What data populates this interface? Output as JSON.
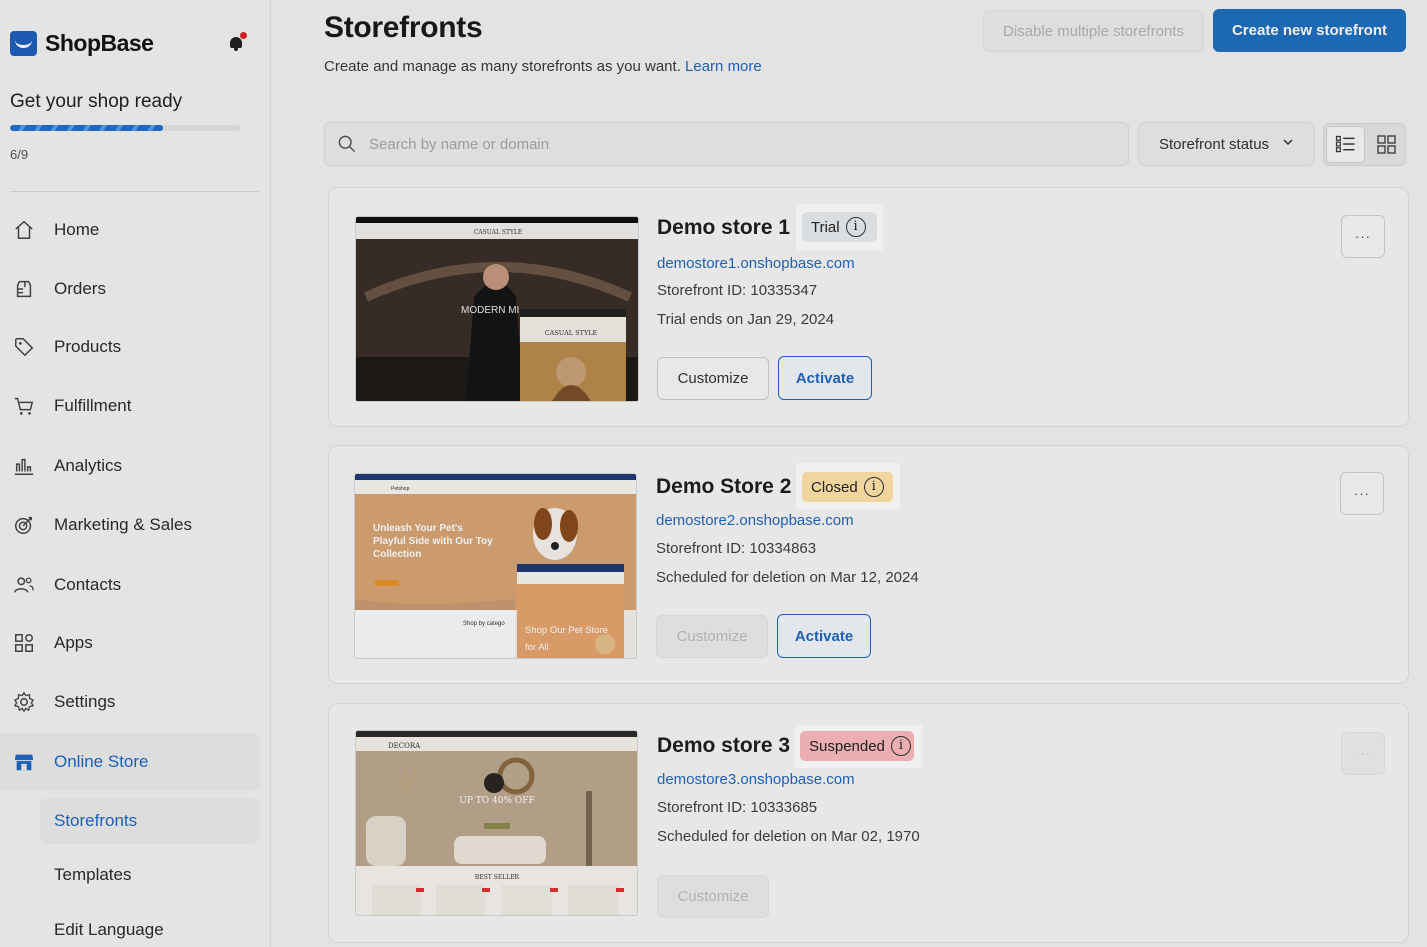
{
  "sidebar": {
    "brand": "ShopBase",
    "onboarding": {
      "title": "Get your shop ready",
      "progress": 0.667,
      "count": "6/9"
    },
    "nav": [
      {
        "label": "Home",
        "icon": "home-icon"
      },
      {
        "label": "Orders",
        "icon": "orders-icon"
      },
      {
        "label": "Products",
        "icon": "tag-icon"
      },
      {
        "label": "Fulfillment",
        "icon": "cart-icon"
      },
      {
        "label": "Analytics",
        "icon": "chart-icon"
      },
      {
        "label": "Marketing & Sales",
        "icon": "target-icon"
      },
      {
        "label": "Contacts",
        "icon": "users-icon"
      },
      {
        "label": "Apps",
        "icon": "apps-icon"
      },
      {
        "label": "Settings",
        "icon": "gear-icon"
      },
      {
        "label": "Online Store",
        "icon": "store-icon"
      }
    ],
    "sub": [
      {
        "label": "Storefronts"
      },
      {
        "label": "Templates"
      },
      {
        "label": "Edit Language"
      }
    ]
  },
  "header": {
    "title": "Storefronts",
    "subtitle": "Create and manage as many storefronts as you want.",
    "learn_more": "Learn more",
    "disable_label": "Disable multiple storefronts",
    "create_label": "Create new storefront"
  },
  "filters": {
    "search_placeholder": "Search by name or domain",
    "status_label": "Storefront status"
  },
  "stores": [
    {
      "name": "Demo store 1",
      "badge": "Trial",
      "badge_color": "#e8ecef",
      "domain": "demostore1.onshopbase.com",
      "storefront_id": "Storefront ID: 10335347",
      "note": "Trial ends on Jan 29, 2024",
      "customize": "Customize",
      "activate": "Activate",
      "thumb": {
        "brand": "CASUAL STYLE",
        "headline": "MODERN MI",
        "sub": "CASUAL STYLE"
      }
    },
    {
      "name": "Demo Store 2",
      "badge": "Closed",
      "badge_color": "#ffe3a8",
      "domain": "demostore2.onshopbase.com",
      "storefront_id": "Storefront ID: 10334863",
      "note": "Scheduled for deletion on Mar 12, 2024",
      "customize": "Customize",
      "activate": "Activate",
      "thumb": {
        "brand": "Petshop",
        "headline": "Unleash Your Pet's Playful Side with Our Toy Collection",
        "sub": "Shop Our Pet Store for All",
        "section": "Shop by catego"
      }
    },
    {
      "name": "Demo store 3",
      "badge": "Suspended",
      "badge_color": "#f9b9bf",
      "domain": "demostore3.onshopbase.com",
      "storefront_id": "Storefront ID: 10333685",
      "note": "Scheduled for deletion on Mar 02, 1970",
      "customize": "Customize",
      "thumb": {
        "brand": "DECORA",
        "headline": "UP TO 40% OFF",
        "section": "BEST SELLER"
      }
    }
  ]
}
